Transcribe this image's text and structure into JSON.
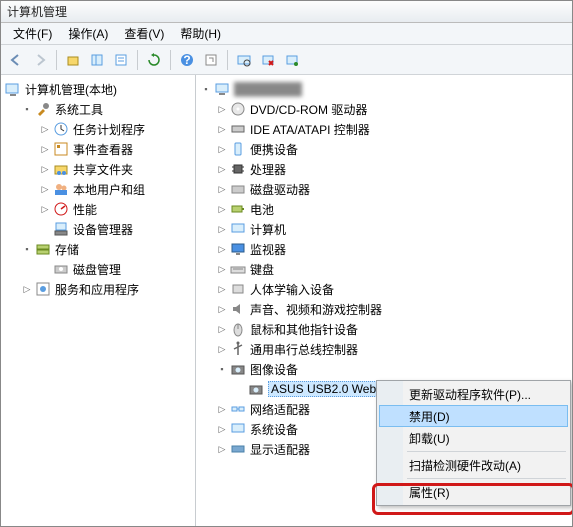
{
  "title": "计算机管理",
  "menu": {
    "file": "文件(F)",
    "action": "操作(A)",
    "view": "查看(V)",
    "help": "帮助(H)"
  },
  "left_tree": {
    "root": "计算机管理(本地)",
    "system_tools": "系统工具",
    "task_scheduler": "任务计划程序",
    "event_viewer": "事件查看器",
    "shared_folders": "共享文件夹",
    "local_users": "本地用户和组",
    "performance": "性能",
    "device_manager": "设备管理器",
    "storage": "存储",
    "disk_mgmt": "磁盘管理",
    "services_apps": "服务和应用程序"
  },
  "right_tree": {
    "dvd": "DVD/CD-ROM 驱动器",
    "ide": "IDE ATA/ATAPI 控制器",
    "portable": "便携设备",
    "cpu": "处理器",
    "disk": "磁盘驱动器",
    "battery": "电池",
    "computer": "计算机",
    "monitor": "监视器",
    "keyboard": "键盘",
    "hid": "人体学输入设备",
    "sound": "声音、视频和游戏控制器",
    "mouse": "鼠标和其他指针设备",
    "usb": "通用串行总线控制器",
    "imaging": "图像设备",
    "webcam": "ASUS USB2.0 WebCam",
    "network": "网络适配器",
    "system": "系统设备",
    "display": "显示适配器"
  },
  "context_menu": {
    "update": "更新驱动程序软件(P)...",
    "disable": "禁用(D)",
    "uninstall": "卸载(U)",
    "scan": "扫描检测硬件改动(A)",
    "properties": "属性(R)"
  }
}
